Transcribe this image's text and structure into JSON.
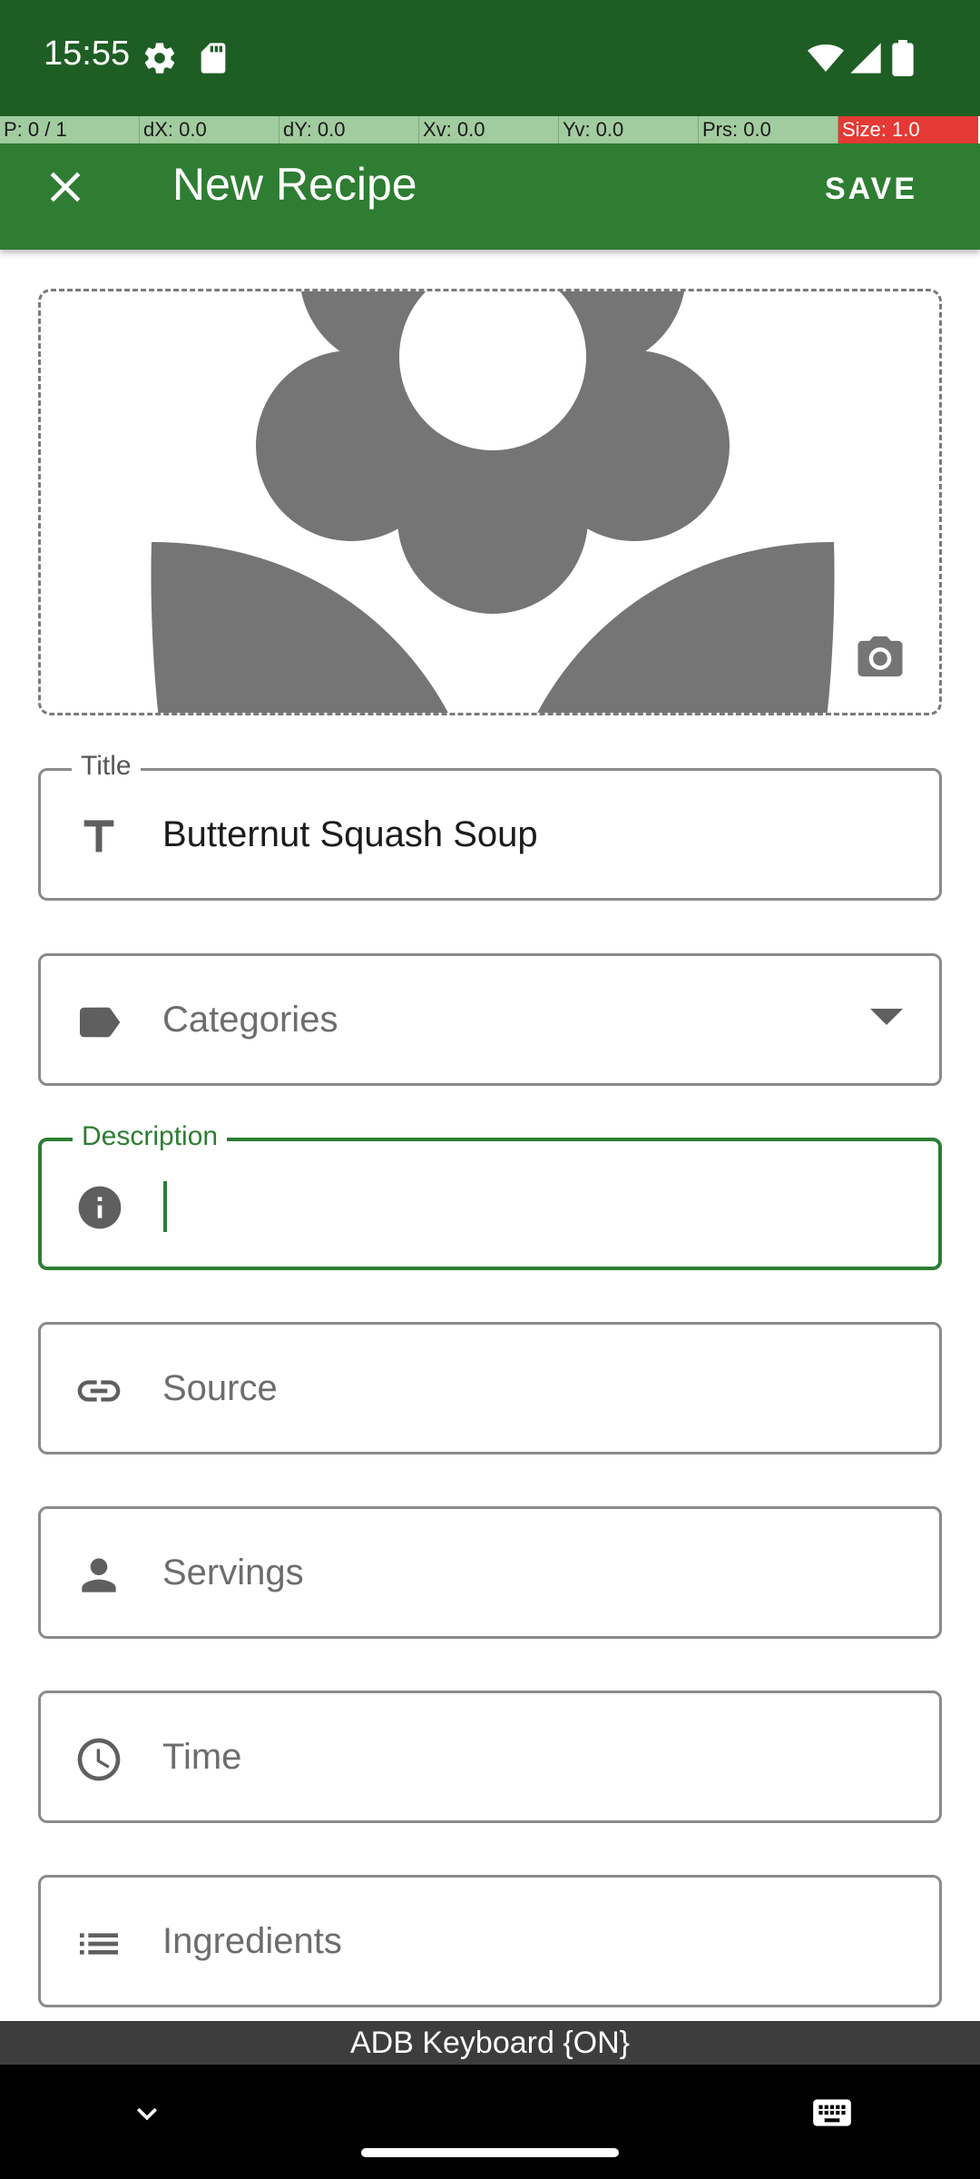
{
  "status_bar": {
    "time": "15:55",
    "icons": [
      "settings-icon",
      "sd-card-icon",
      "wifi-icon",
      "signal-icon",
      "battery-icon"
    ]
  },
  "pointer_overlay": {
    "cells": [
      "P: 0 / 1",
      "dX: 0.0",
      "dY: 0.0",
      "Xv: 0.0",
      "Yv: 0.0",
      "Prs: 0.0",
      "Size: 1.0"
    ]
  },
  "toolbar": {
    "title": "New Recipe",
    "save_label": "SAVE",
    "close_icon": "close-icon"
  },
  "image_area": {
    "placeholder_icon": "flower-icon",
    "camera_icon": "camera-icon"
  },
  "fields": {
    "title": {
      "label": "Title",
      "value": "Butternut Squash Soup",
      "icon": "text-icon"
    },
    "categories": {
      "placeholder": "Categories",
      "icon": "label-icon"
    },
    "description": {
      "label": "Description",
      "value": "",
      "icon": "info-icon"
    },
    "source": {
      "placeholder": "Source",
      "icon": "link-icon"
    },
    "servings": {
      "placeholder": "Servings",
      "icon": "person-icon"
    },
    "time": {
      "placeholder": "Time",
      "icon": "clock-icon"
    },
    "ingredients": {
      "placeholder": "Ingredients",
      "icon": "list-icon"
    }
  },
  "keyboard_banner": "ADB Keyboard {ON}",
  "colors": {
    "primary": "#2e7d32",
    "primary_dark": "#1e5e24",
    "accent_overlay": "#a1cc9f",
    "overlay_alert": "#e53935"
  }
}
